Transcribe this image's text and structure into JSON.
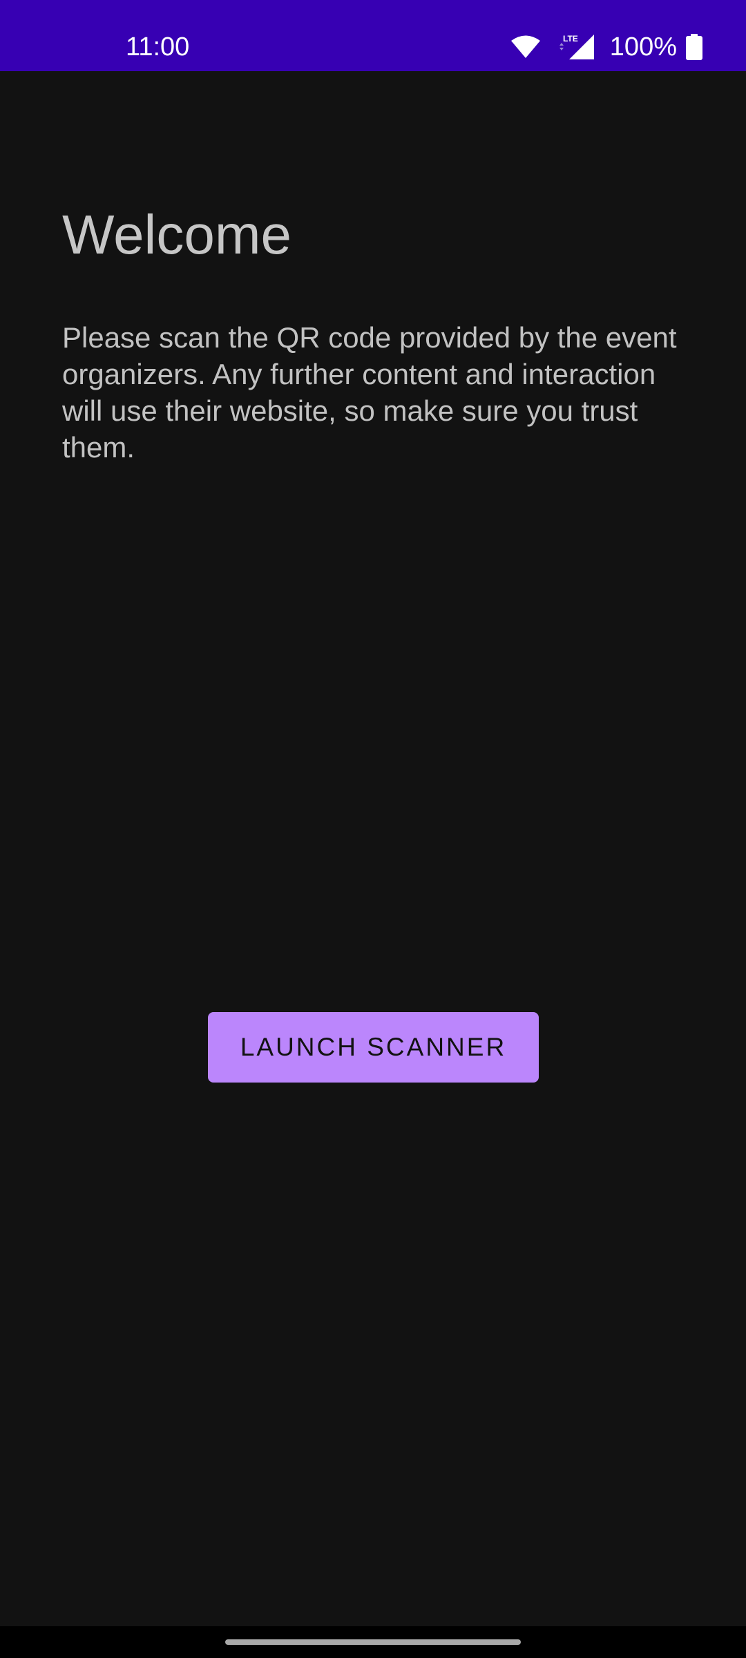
{
  "status_bar": {
    "time": "11:00",
    "network": "LTE",
    "battery": "100%",
    "background_color": "#3700B3"
  },
  "main": {
    "title": "Welcome",
    "description": "Please scan the QR code provided by the event organizers. Any further content and interaction will use their website, so make sure you trust them.",
    "launch_button_label": "LAUNCH SCANNER",
    "accent_color": "#BB86FC",
    "background_color": "#121212"
  }
}
